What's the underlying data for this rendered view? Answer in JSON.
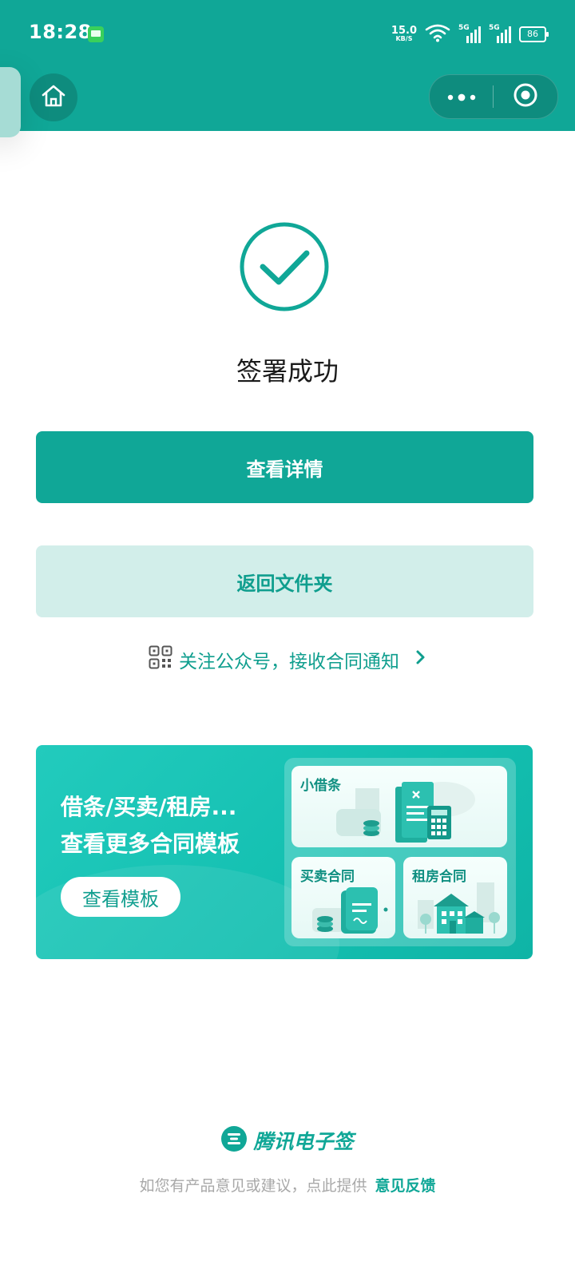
{
  "status_bar": {
    "time": "18:28",
    "net_speed_value": "15.0",
    "net_speed_unit": "KB/S",
    "signal_1_label": "5G",
    "signal_2_label": "5G",
    "battery_level": "86"
  },
  "success": {
    "title": "签署成功"
  },
  "actions": {
    "view_details_label": "查看详情",
    "back_to_folder_label": "返回文件夹"
  },
  "follow": {
    "text": "关注公众号，接收合同通知"
  },
  "banner": {
    "line1": "借条/买卖/租房...",
    "line2": "查看更多合同模板",
    "button_label": "查看模板",
    "cards": {
      "loan": "小借条",
      "sale": "买卖合同",
      "rent": "租房合同"
    }
  },
  "footer": {
    "brand_name": "腾讯电子签",
    "note": "如您有产品意见或建议，点此提供",
    "feedback_link": "意见反馈"
  },
  "colors": {
    "primary": "#10a797",
    "primary_light": "#d2eeea",
    "banner": "#1ec6b8"
  }
}
